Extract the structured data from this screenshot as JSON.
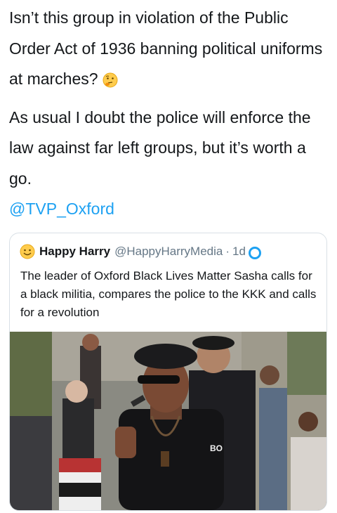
{
  "tweet": {
    "paragraph1": "Isn’t this group in violation of the Public Order Act of 1936 banning political uniforms at marches?",
    "emoji_icon": "thinking-face-emoji",
    "paragraph2": "As usual I doubt the police will enforce the law against far left groups, but it’s worth a go.",
    "mention": "@TVP_Oxford"
  },
  "quote": {
    "avatar_icon": "smiley-face-emoji",
    "display_name": "Happy Harry",
    "handle": "@HappyHarryMedia",
    "separator": "·",
    "age": "1d",
    "text": "The leader of Oxford Black Lives Matter Sasha calls for a black militia, compares the police to the KKK and calls for a revolution",
    "photo_shirt_text": "BO"
  },
  "colors": {
    "link": "#1da1f2",
    "text": "#14171a",
    "meta": "#657786",
    "border": "#d9e0e6"
  }
}
